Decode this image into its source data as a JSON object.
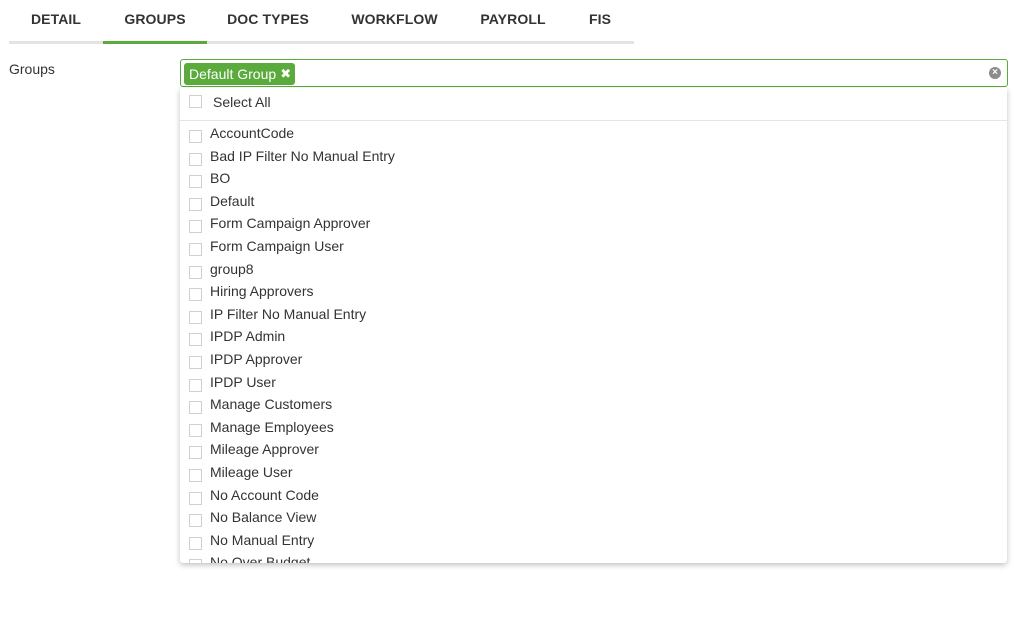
{
  "tabs": [
    {
      "label": "DETAIL",
      "active": false
    },
    {
      "label": "GROUPS",
      "active": true
    },
    {
      "label": "DOC TYPES",
      "active": false
    },
    {
      "label": "WORKFLOW",
      "active": false
    },
    {
      "label": "PAYROLL",
      "active": false
    },
    {
      "label": "FIS",
      "active": false
    }
  ],
  "groups_field": {
    "label": "Groups",
    "selected_chip": "Default Group",
    "chip_remove_icon": "✖",
    "clear_icon": "×"
  },
  "dropdown": {
    "select_all_label": "Select All",
    "options": [
      "AccountCode",
      "Bad IP Filter No Manual Entry",
      "BO",
      "Default",
      "Form Campaign Approver",
      "Form Campaign User",
      "group8",
      "Hiring Approvers",
      "IP Filter No Manual Entry",
      "IPDP Admin",
      "IPDP Approver",
      "IPDP User",
      "Manage Customers",
      "Manage Employees",
      "Mileage Approver",
      "Mileage User",
      "No Account Code",
      "No Balance View",
      "No Manual Entry",
      "No Over Budget"
    ]
  },
  "colors": {
    "accent": "#5aab3c",
    "tab_underline": "#e3e3e3"
  }
}
